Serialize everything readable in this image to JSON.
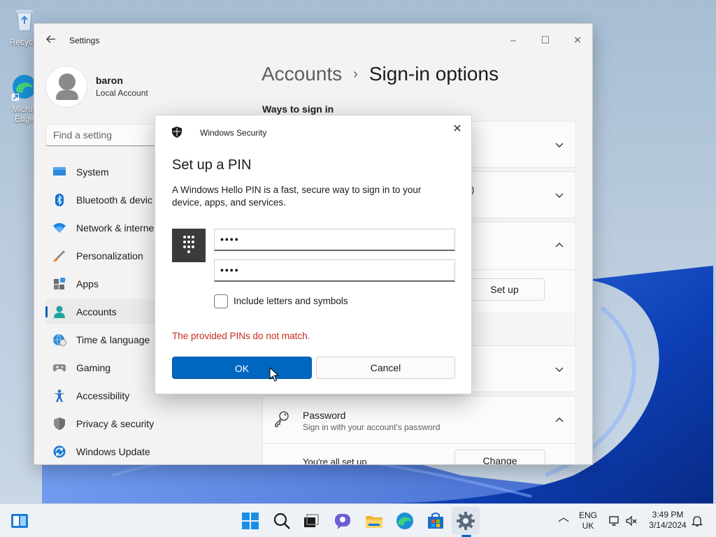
{
  "desktop": {
    "icons": [
      {
        "label": "Recycle"
      },
      {
        "label": "Micros Edge"
      }
    ]
  },
  "window": {
    "title": "Settings",
    "back_icon": "arrow-left-icon",
    "controls": {
      "minimize": "–",
      "maximize": "☐",
      "close": "✕"
    }
  },
  "user": {
    "name": "baron",
    "type": "Local Account"
  },
  "search": {
    "placeholder": "Find a setting"
  },
  "nav": [
    {
      "label": "System",
      "icon": "monitor-icon"
    },
    {
      "label": "Bluetooth & devic",
      "icon": "bluetooth-icon"
    },
    {
      "label": "Network & interne",
      "icon": "wifi-icon"
    },
    {
      "label": "Personalization",
      "icon": "brush-icon"
    },
    {
      "label": "Apps",
      "icon": "apps-icon"
    },
    {
      "label": "Accounts",
      "icon": "person-icon",
      "active": true
    },
    {
      "label": "Time & language",
      "icon": "globe-clock-icon"
    },
    {
      "label": "Gaming",
      "icon": "gamepad-icon"
    },
    {
      "label": "Accessibility",
      "icon": "accessibility-icon"
    },
    {
      "label": "Privacy & security",
      "icon": "shield-icon"
    },
    {
      "label": "Windows Update",
      "icon": "update-icon"
    }
  ],
  "breadcrumb": {
    "parent": "Accounts",
    "separator": "›",
    "current": "Sign-in options"
  },
  "main": {
    "section_title": "Ways to sign in",
    "partial_text": ")",
    "setup_button": "Set up",
    "password": {
      "title": "Password",
      "subtitle": "Sign in with your account's password",
      "status": "You're all set up",
      "change_button": "Change"
    }
  },
  "dialog": {
    "app_name": "Windows Security",
    "heading": "Set up a PIN",
    "description": "A Windows Hello PIN is a fast, secure way to sign in to your device, apps, and services.",
    "pin_value": "••••",
    "confirm_value": "••••",
    "checkbox_label": "Include letters and symbols",
    "checkbox_checked": false,
    "error": "The provided PINs do not match.",
    "ok": "OK",
    "cancel": "Cancel",
    "close": "✕"
  },
  "taskbar": {
    "language": "ENG",
    "region": "UK",
    "time": "3:49 PM",
    "date": "3/14/2024",
    "chevron": "︿"
  },
  "colors": {
    "accent": "#0067c0",
    "error": "#c42b1c"
  }
}
